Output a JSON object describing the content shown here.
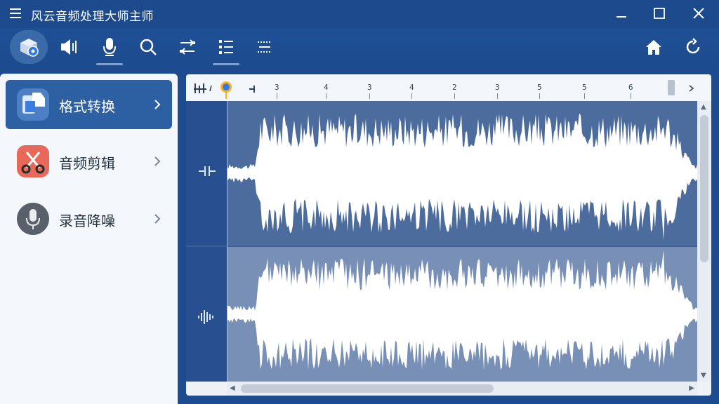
{
  "app": {
    "title": "风云音频处理大师主师"
  },
  "colors": {
    "titlebar": "#1d4a8d",
    "active_item": "#2d5fa3",
    "waveform": "#ffffff",
    "track_bg": "#4d6c9e"
  },
  "toolbar": {
    "buttons": [
      {
        "name": "format-convert-icon"
      },
      {
        "name": "speaker-icon"
      },
      {
        "name": "microphone-icon"
      },
      {
        "name": "search-icon"
      },
      {
        "name": "transfer-arrows-icon"
      },
      {
        "name": "list-icon"
      },
      {
        "name": "dotted-grid-icon"
      }
    ],
    "right": [
      {
        "name": "home-icon"
      },
      {
        "name": "refresh-icon"
      }
    ]
  },
  "sidebar": {
    "items": [
      {
        "label": "格式转换",
        "icon": "document-convert-icon",
        "active": true
      },
      {
        "label": "音频剪辑",
        "icon": "scissors-icon",
        "active": false
      },
      {
        "label": "录音降噪",
        "icon": "microphone-icon",
        "active": false
      }
    ]
  },
  "ruler": {
    "ticks": [
      "3",
      "4",
      "3",
      "4",
      "2",
      "3",
      "5",
      "5",
      "6"
    ]
  }
}
